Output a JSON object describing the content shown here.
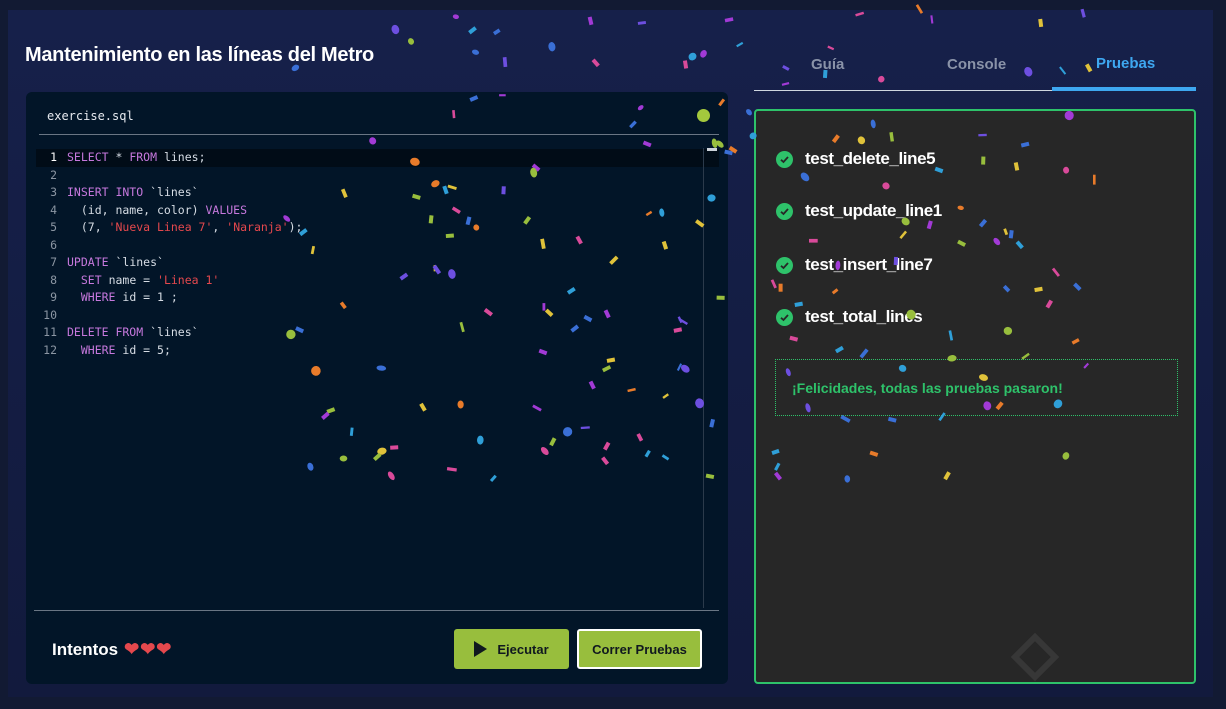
{
  "page": {
    "title": "Mantenimiento en las líneas del Metro"
  },
  "editor": {
    "filename": "exercise.sql",
    "lines": [
      {
        "num": "1",
        "tokens": [
          {
            "t": "kw",
            "v": "SELECT"
          },
          {
            "t": "txt",
            "v": " * "
          },
          {
            "t": "kw",
            "v": "FROM"
          },
          {
            "t": "txt",
            "v": " lines;"
          }
        ]
      },
      {
        "num": "2",
        "tokens": []
      },
      {
        "num": "3",
        "tokens": [
          {
            "t": "kw",
            "v": "INSERT INTO"
          },
          {
            "t": "txt",
            "v": " `lines`"
          }
        ]
      },
      {
        "num": "4",
        "tokens": [
          {
            "t": "txt",
            "v": "  (id, name, color) "
          },
          {
            "t": "kw",
            "v": "VALUES"
          }
        ]
      },
      {
        "num": "5",
        "tokens": [
          {
            "t": "txt",
            "v": "  (7, "
          },
          {
            "t": "st",
            "v": "'Nueva Linea 7'"
          },
          {
            "t": "txt",
            "v": ", "
          },
          {
            "t": "st",
            "v": "'Naranja'"
          },
          {
            "t": "txt",
            "v": ");"
          }
        ]
      },
      {
        "num": "6",
        "tokens": []
      },
      {
        "num": "7",
        "tokens": [
          {
            "t": "kw",
            "v": "UPDATE"
          },
          {
            "t": "txt",
            "v": " `lines`"
          }
        ]
      },
      {
        "num": "8",
        "tokens": [
          {
            "t": "txt",
            "v": "  "
          },
          {
            "t": "kw",
            "v": "SET"
          },
          {
            "t": "txt",
            "v": " name = "
          },
          {
            "t": "st",
            "v": "'Linea 1'"
          }
        ]
      },
      {
        "num": "9",
        "tokens": [
          {
            "t": "txt",
            "v": "  "
          },
          {
            "t": "kw",
            "v": "WHERE"
          },
          {
            "t": "txt",
            "v": " id = 1 ;"
          }
        ]
      },
      {
        "num": "10",
        "tokens": []
      },
      {
        "num": "11",
        "tokens": [
          {
            "t": "kw",
            "v": "DELETE FROM"
          },
          {
            "t": "txt",
            "v": " `lines`"
          }
        ]
      },
      {
        "num": "12",
        "tokens": [
          {
            "t": "txt",
            "v": "  "
          },
          {
            "t": "kw",
            "v": "WHERE"
          },
          {
            "t": "txt",
            "v": " id = 5;"
          }
        ]
      }
    ]
  },
  "footer": {
    "attempts_label": "Intentos",
    "hearts": "❤❤❤",
    "run_label": "Ejecutar",
    "tests_label": "Correr Pruebas"
  },
  "tabs": {
    "guide": "Guía",
    "console": "Console",
    "tests": "Pruebas"
  },
  "results": {
    "tests": [
      "test_delete_line5",
      "test_update_line1",
      "test_insert_line7",
      "test_total_lines"
    ],
    "message": "¡Felicidades, todas las pruebas pasaron!"
  },
  "colors": {
    "accent_green": "#98be3d",
    "success": "#2ec26a",
    "tab_active": "#3ea7f0",
    "keyword": "#c678dd",
    "string": "#e5484d"
  },
  "icons": [
    "play-icon",
    "check-circle-icon",
    "heart-icon",
    "status-dot-icon"
  ]
}
